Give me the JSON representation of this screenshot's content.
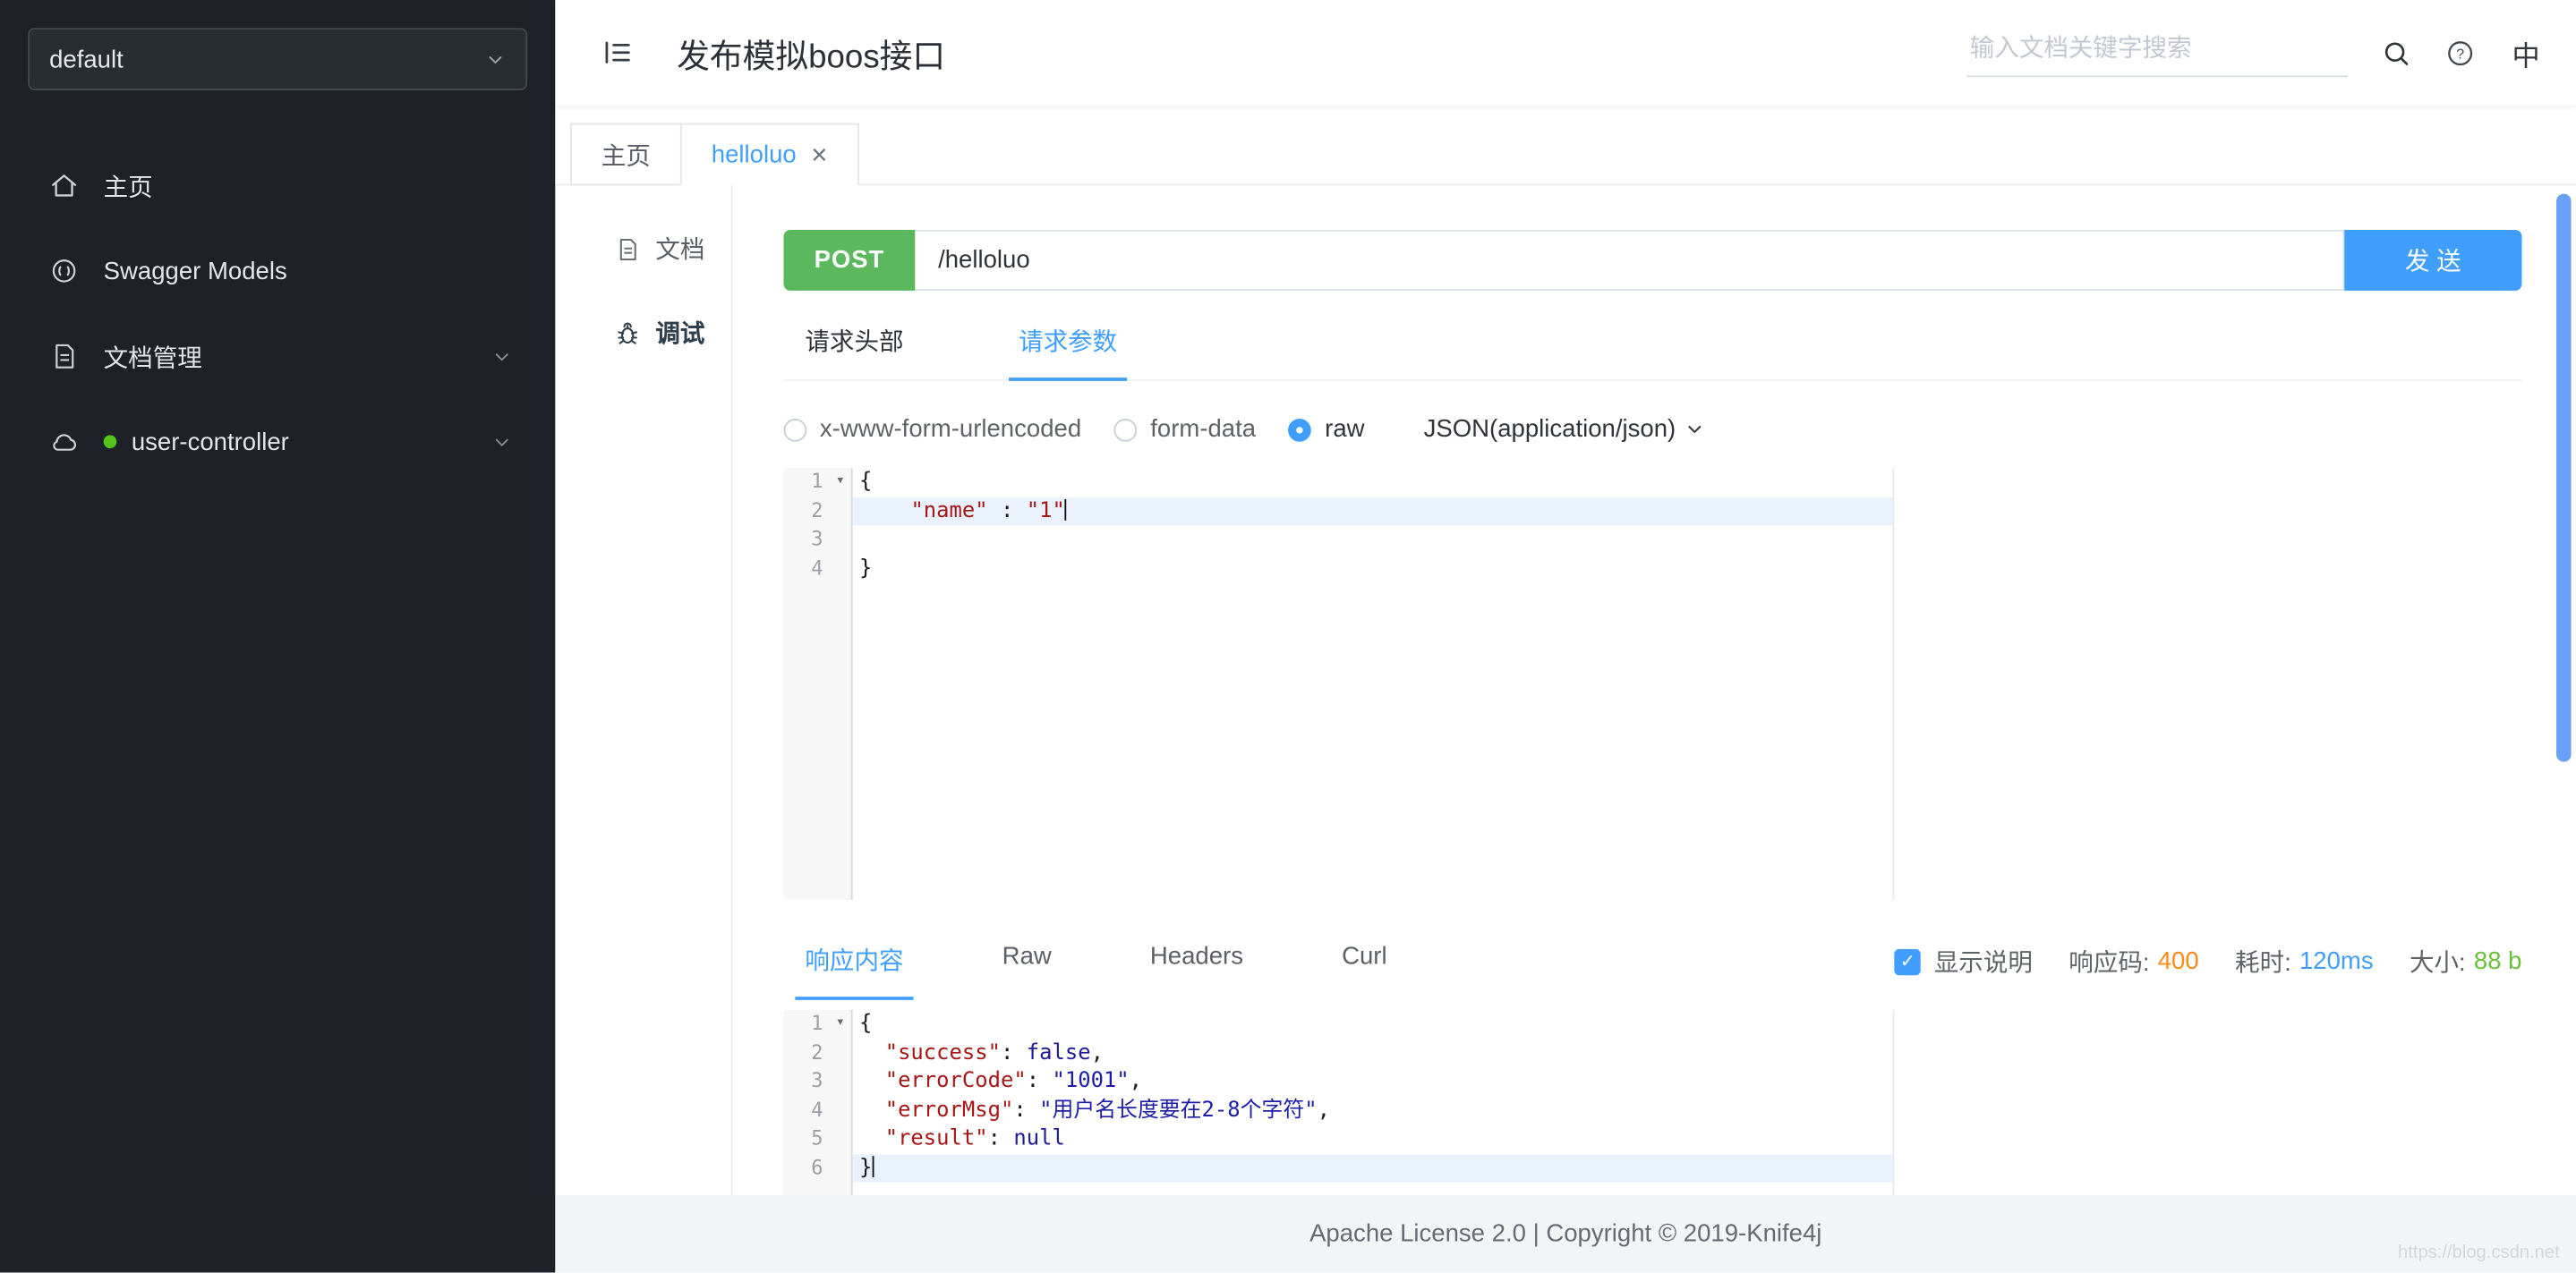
{
  "sidebar": {
    "group_select": {
      "value": "default"
    },
    "items": [
      {
        "id": "home",
        "icon": "home-icon",
        "label": "主页"
      },
      {
        "id": "swagger-models",
        "icon": "swagger-icon",
        "label": "Swagger Models"
      },
      {
        "id": "doc-manage",
        "icon": "docs-icon",
        "label": "文档管理",
        "expandable": true
      },
      {
        "id": "user-controller",
        "icon": "cloud-icon",
        "label": "user-controller",
        "expandable": true,
        "status_dot": true
      }
    ]
  },
  "header": {
    "title": "发布模拟boos接口",
    "search_placeholder": "输入文档关键字搜索",
    "lang_toggle": "中"
  },
  "tabs": [
    {
      "id": "home",
      "label": "主页"
    },
    {
      "id": "helloluo",
      "label": "helloluo",
      "active": true,
      "closable": true
    }
  ],
  "doc_nav": {
    "doc_label": "文档",
    "debug_label": "调试"
  },
  "debug": {
    "method": "POST",
    "url": "/helloluo",
    "send_label": "发 送",
    "request_tabs": [
      {
        "label": "请求头部"
      },
      {
        "label": "请求参数",
        "active": true
      }
    ],
    "body_types": [
      {
        "label": "x-www-form-urlencoded"
      },
      {
        "label": "form-data"
      },
      {
        "label": "raw",
        "selected": true
      }
    ],
    "content_type": "JSON(application/json)",
    "request_code": {
      "lines": [
        {
          "fold": true,
          "tokens": [
            {
              "t": "{",
              "c": "p"
            }
          ]
        },
        {
          "active": true,
          "cursor": true,
          "tokens": [
            {
              "t": "    ",
              "c": "p"
            },
            {
              "t": "\"name\"",
              "c": "k"
            },
            {
              "t": " : ",
              "c": "p"
            },
            {
              "t": "\"1\"",
              "c": "s"
            }
          ]
        },
        {
          "tokens": []
        },
        {
          "tokens": [
            {
              "t": "}",
              "c": "p"
            }
          ]
        }
      ]
    }
  },
  "response": {
    "tabs": [
      {
        "label": "响应内容",
        "active": true
      },
      {
        "label": "Raw"
      },
      {
        "label": "Headers"
      },
      {
        "label": "Curl"
      }
    ],
    "show_desc": {
      "checked": true,
      "label": "显示说明"
    },
    "meta": {
      "code_label": "响应码:",
      "code_value": "400",
      "time_label": "耗时:",
      "time_value": "120ms",
      "size_label": "大小:",
      "size_value": "88 b"
    },
    "code": {
      "lines": [
        {
          "fold": true,
          "tokens": [
            {
              "t": "{",
              "c": "p"
            }
          ]
        },
        {
          "tokens": [
            {
              "t": "  ",
              "c": "p"
            },
            {
              "t": "\"success\"",
              "c": "k"
            },
            {
              "t": ": ",
              "c": "p"
            },
            {
              "t": "false",
              "c": "a"
            },
            {
              "t": ",",
              "c": "p"
            }
          ]
        },
        {
          "tokens": [
            {
              "t": "  ",
              "c": "p"
            },
            {
              "t": "\"errorCode\"",
              "c": "k"
            },
            {
              "t": ": ",
              "c": "p"
            },
            {
              "t": "\"1001\"",
              "c": "v"
            },
            {
              "t": ",",
              "c": "p"
            }
          ]
        },
        {
          "tokens": [
            {
              "t": "  ",
              "c": "p"
            },
            {
              "t": "\"errorMsg\"",
              "c": "k"
            },
            {
              "t": ": ",
              "c": "p"
            },
            {
              "t": "\"用户名长度要在2-8个字符\"",
              "c": "v"
            },
            {
              "t": ",",
              "c": "p"
            }
          ]
        },
        {
          "tokens": [
            {
              "t": "  ",
              "c": "p"
            },
            {
              "t": "\"result\"",
              "c": "k"
            },
            {
              "t": ": ",
              "c": "p"
            },
            {
              "t": "null",
              "c": "a"
            }
          ]
        },
        {
          "active": true,
          "cursor": true,
          "tokens": [
            {
              "t": "}",
              "c": "p"
            }
          ]
        }
      ]
    }
  },
  "footer": {
    "text": "Apache License 2.0 | Copyright © 2019-Knife4j",
    "watermark": "https://blog.csdn.net"
  },
  "colors": {
    "accent": "#409eff",
    "method_post": "#5cb85c",
    "status_code": "#fa8c16",
    "time": "#409eff",
    "size": "#67c23a",
    "sidebar_bg": "#1e2228"
  }
}
